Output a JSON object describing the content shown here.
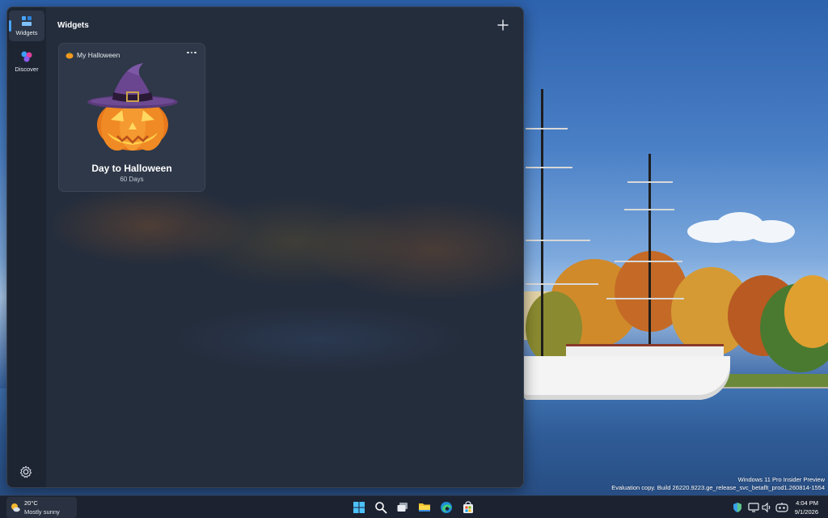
{
  "board": {
    "title": "Widgets",
    "add_button": "plus-icon",
    "nav": [
      {
        "label": "Widgets",
        "icon": "widgets-icon",
        "active": true
      },
      {
        "label": "Discover",
        "icon": "discover-icon",
        "active": false
      }
    ],
    "settings_icon": "gear-icon"
  },
  "widget": {
    "name": "My Halloween",
    "icon": "pumpkin-icon",
    "title": "Day to Halloween",
    "subtitle": "60 Days",
    "image": "jack-o-lantern-witch-hat"
  },
  "watermark": {
    "line1": "Windows 11 Pro Insider Preview",
    "line2": "Evaluation copy. Build 26220.9223.ge_release_svc_betaflt_prod1.260814-1554"
  },
  "taskbar": {
    "weather": {
      "temp": "20°C",
      "condition": "Mostly sunny",
      "icon": "partly-sunny-icon"
    },
    "apps": [
      "start-icon",
      "search-icon",
      "task-view-icon",
      "file-explorer-icon",
      "edge-icon",
      "store-icon"
    ],
    "tray": [
      "defender-icon",
      "network-icon",
      "volume-icon",
      "copilot-icon"
    ],
    "time": "4:04 PM",
    "date": "9/1/2026"
  },
  "colors": {
    "accent": "#4aa3ff",
    "board_bg": "#242d3c",
    "card_bg": "#2e3848",
    "taskbar_bg": "#1c2230"
  }
}
